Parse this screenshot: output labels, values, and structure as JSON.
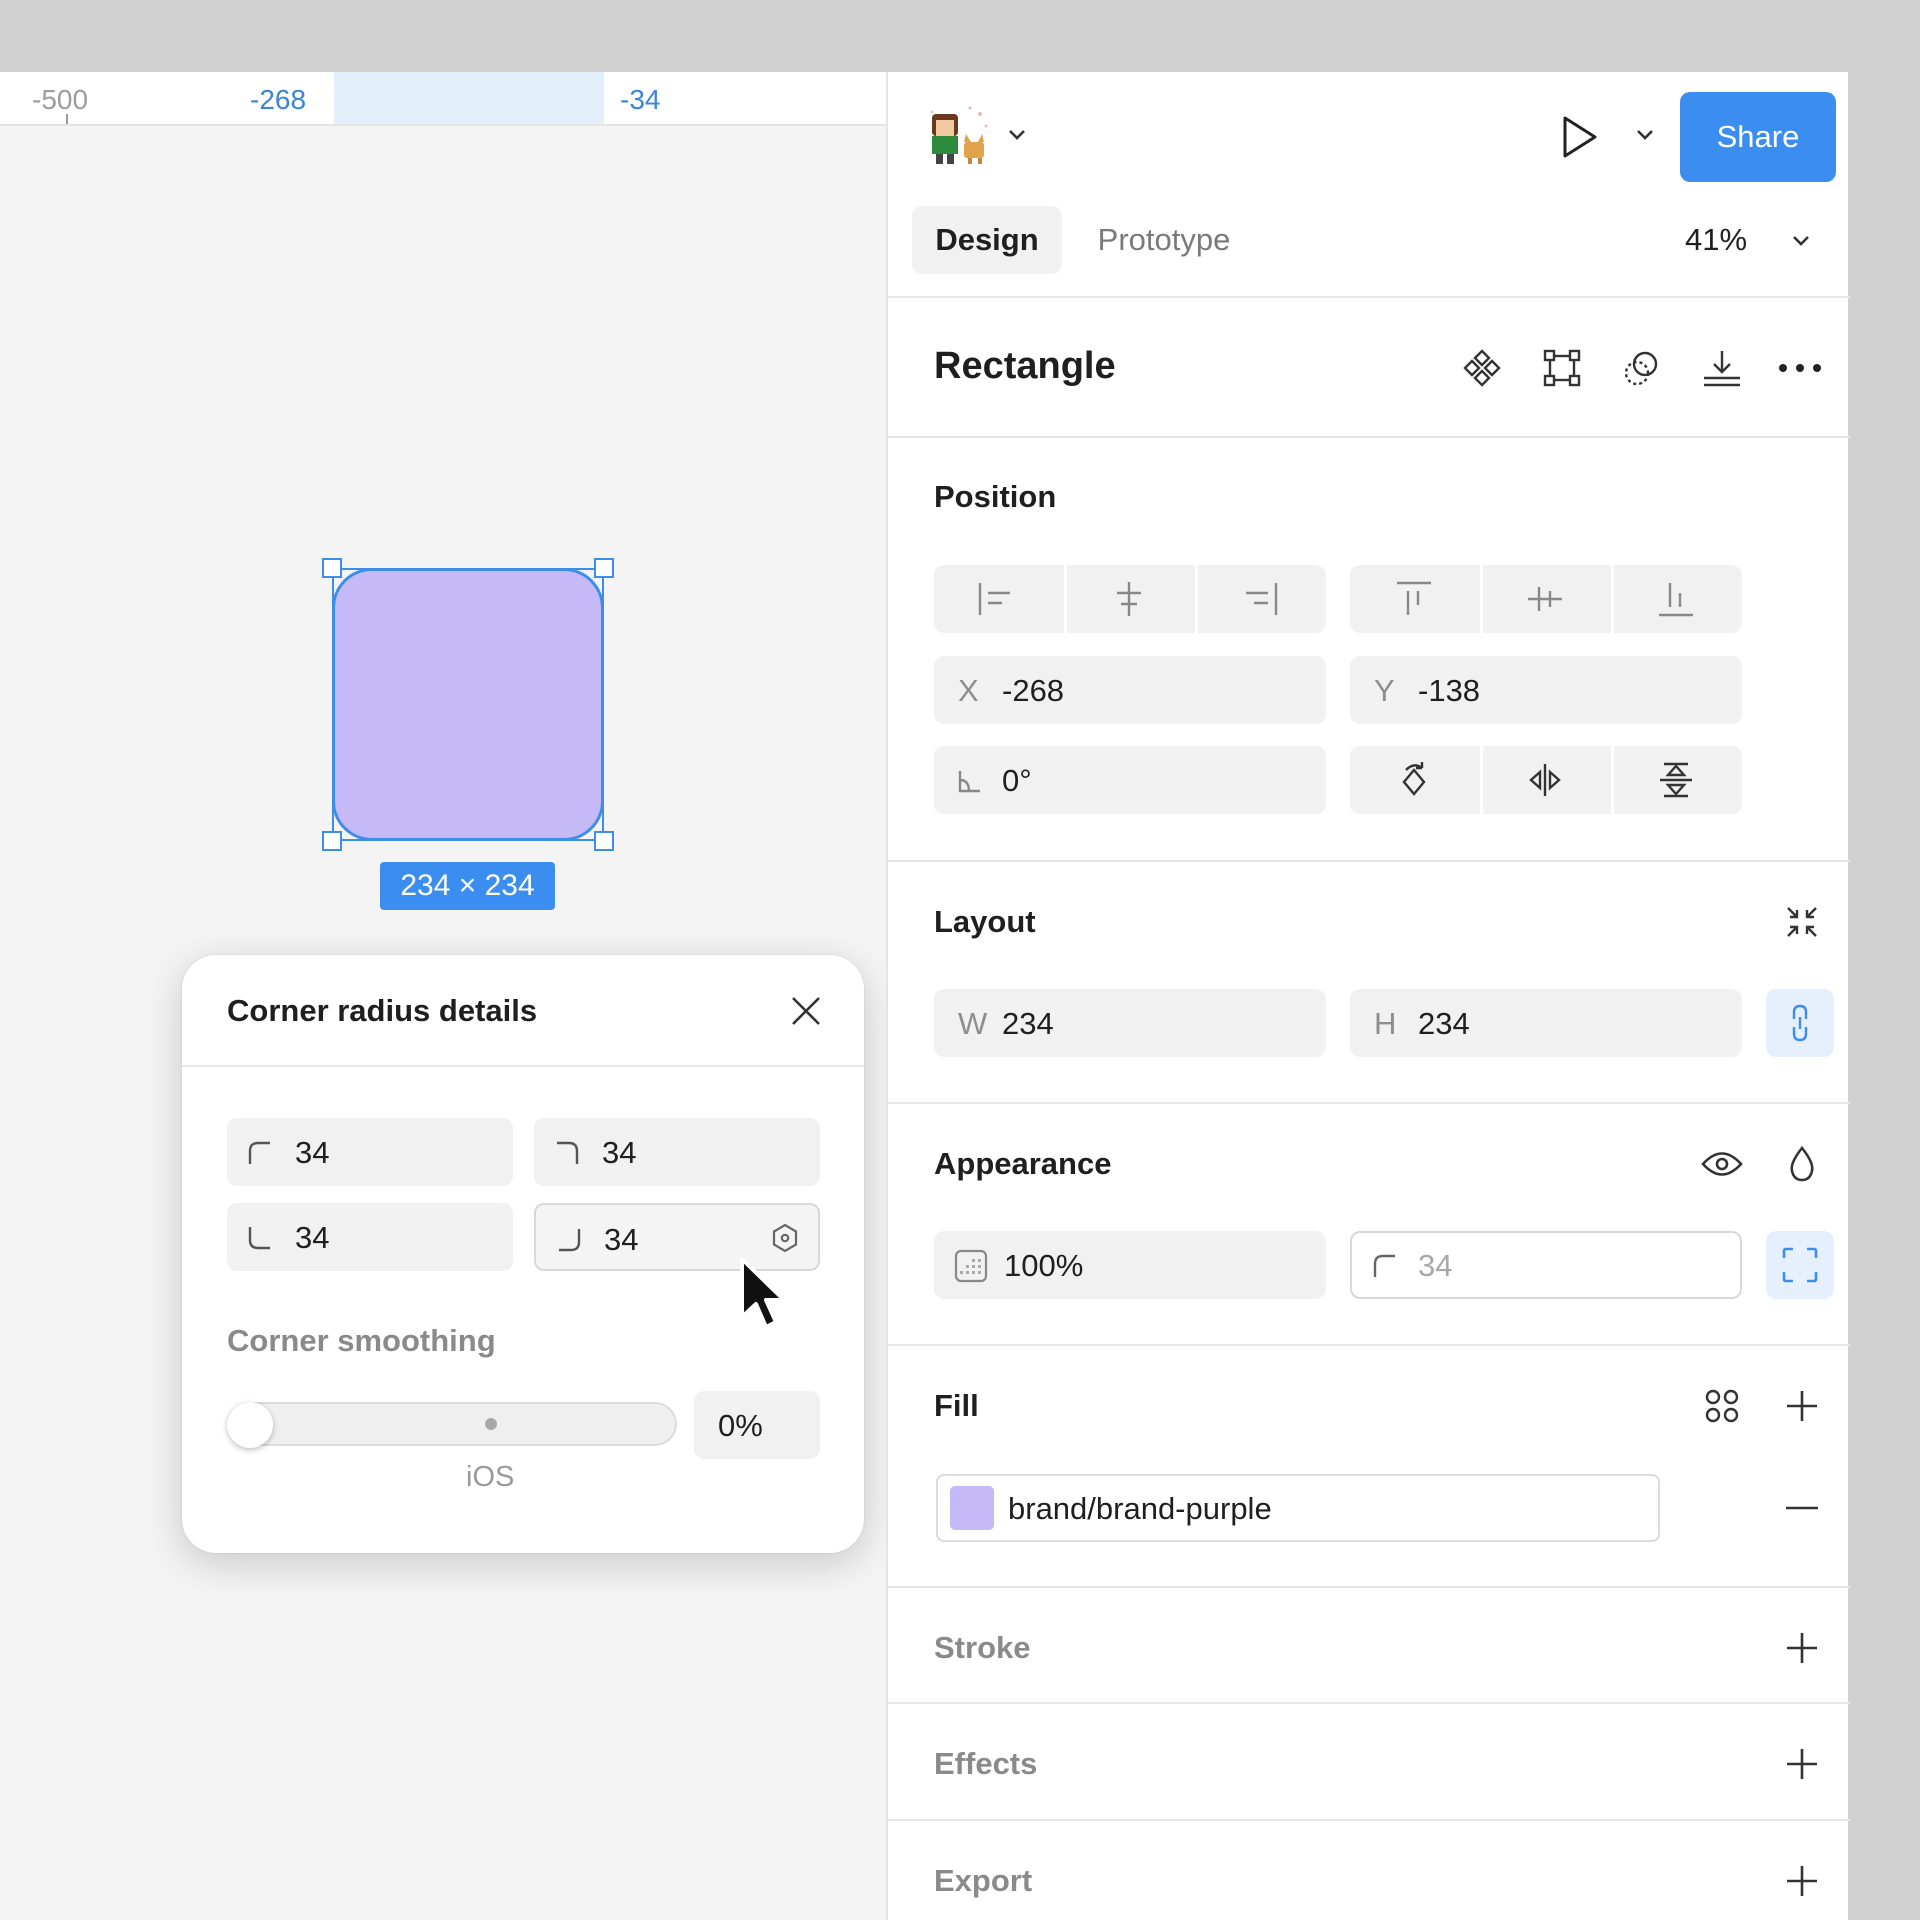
{
  "ruler": {
    "labels": [
      "-500",
      "-268",
      "-34"
    ]
  },
  "canvas": {
    "selection_size": "234 × 234",
    "fill_color": "#c6b9f7",
    "selection_color": "#3d8ee8"
  },
  "corner_popup": {
    "title": "Corner radius details",
    "top_left": "34",
    "top_right": "34",
    "bottom_left": "34",
    "bottom_right": "34",
    "smoothing_label": "Corner smoothing",
    "smoothing_value": "0%",
    "smoothing_level": 0,
    "ios_label": "iOS"
  },
  "header": {
    "share_label": "Share",
    "share_color": "#3b8ef0"
  },
  "tabs": {
    "design": "Design",
    "prototype": "Prototype",
    "zoom": "41%"
  },
  "layer": {
    "name": "Rectangle"
  },
  "position": {
    "title": "Position",
    "x_label": "X",
    "x_value": "-268",
    "y_label": "Y",
    "y_value": "-138",
    "rotation": "0°"
  },
  "layout": {
    "title": "Layout",
    "w_label": "W",
    "w_value": "234",
    "h_label": "H",
    "h_value": "234"
  },
  "appearance": {
    "title": "Appearance",
    "opacity": "100%",
    "radius": "34"
  },
  "fill": {
    "title": "Fill",
    "style_name": "brand/brand-purple",
    "swatch": "#c6b9f7"
  },
  "stroke": {
    "title": "Stroke"
  },
  "effects": {
    "title": "Effects"
  },
  "export": {
    "title": "Export"
  }
}
